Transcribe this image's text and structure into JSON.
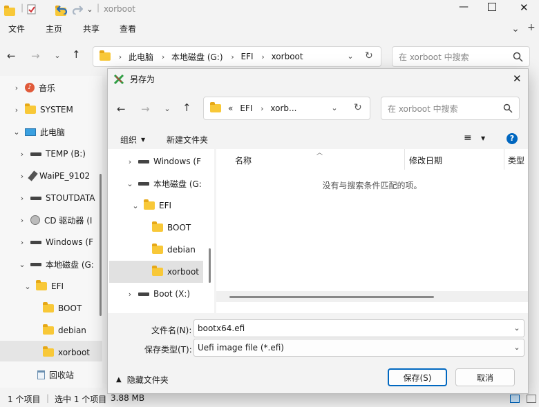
{
  "explorer": {
    "title": "xorboot",
    "menu": [
      "文件",
      "主页",
      "共享",
      "查看"
    ],
    "address": [
      "此电脑",
      "本地磁盘 (G:)",
      "EFI",
      "xorboot"
    ],
    "search_placeholder": "在 xorboot 中搜索",
    "sidebar": [
      {
        "label": "音乐",
        "icon": "music-icon"
      },
      {
        "label": "SYSTEM",
        "icon": "folder-icon"
      },
      {
        "label": "此电脑",
        "icon": "computer-icon"
      },
      {
        "label": "TEMP (B:)",
        "icon": "drive-icon"
      },
      {
        "label": "WaiPE_9102",
        "icon": "usb-drive-icon"
      },
      {
        "label": "STOUTDATA",
        "icon": "drive-icon"
      },
      {
        "label": "CD 驱动器 (I",
        "icon": "cd-drive-icon"
      },
      {
        "label": "Windows (F",
        "icon": "drive-icon"
      },
      {
        "label": "本地磁盘 (G:",
        "icon": "drive-icon"
      },
      {
        "label": "EFI",
        "icon": "folder-icon"
      },
      {
        "label": "BOOT",
        "icon": "folder-icon"
      },
      {
        "label": "debian",
        "icon": "folder-icon"
      },
      {
        "label": "xorboot",
        "icon": "folder-icon"
      },
      {
        "label": "回收站",
        "icon": "recycle-bin-icon"
      }
    ],
    "status": {
      "count": "1 个项目",
      "selected": "选中 1 个项目",
      "size": "3.88 MB"
    }
  },
  "dialog": {
    "title": "另存为",
    "address": [
      "«",
      "EFI",
      "xorb..."
    ],
    "search_placeholder": "在 xorboot 中搜索",
    "organize": "组织",
    "new_folder": "新建文件夹",
    "tree": [
      "Windows (F",
      "本地磁盘 (G:",
      "EFI",
      "BOOT",
      "debian",
      "xorboot",
      "Boot (X:)"
    ],
    "columns": [
      "名称",
      "修改日期",
      "类型"
    ],
    "empty_message": "没有与搜索条件匹配的项。",
    "filename_label": "文件名(N):",
    "filename_value": "bootx64.efi",
    "filetype_label": "保存类型(T):",
    "filetype_value": "Uefi image file (*.efi)",
    "hide_folders": "隐藏文件夹",
    "save": "保存(S)",
    "cancel": "取消"
  },
  "colors": {
    "accent": "#0067c0",
    "folder": "#f8c838",
    "selected_bg": "#cce8ff"
  }
}
